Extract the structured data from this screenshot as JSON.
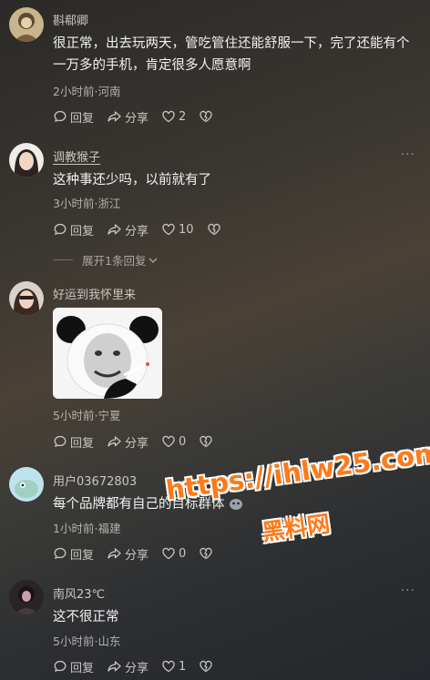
{
  "comments": [
    {
      "username": "斟郗卿",
      "text": "很正常，出去玩两天，管吃管住还能舒服一下，完了还能有个一万多的手机，肯定很多人愿意啊",
      "time": "2小时前",
      "location": "河南",
      "reply": "回复",
      "share": "分享",
      "likes": "2"
    },
    {
      "username": "调教猴子",
      "text": "这种事还少吗，以前就有了",
      "time": "3小时前",
      "location": "浙江",
      "reply": "回复",
      "share": "分享",
      "likes": "10",
      "more": "···",
      "expand": "展开1条回复"
    },
    {
      "username": "好运到我怀里来",
      "text": "",
      "time": "5小时前",
      "location": "宁夏",
      "reply": "回复",
      "share": "分享",
      "likes": "0"
    },
    {
      "username": "用户03672803",
      "text": "每个品牌都有自己的目标群体",
      "time": "1小时前",
      "location": "福建",
      "reply": "回复",
      "share": "分享",
      "likes": "0"
    },
    {
      "username": "南风23℃",
      "text": "这不很正常",
      "time": "5小时前",
      "location": "山东",
      "reply": "回复",
      "share": "分享",
      "likes": "1",
      "more": "···"
    }
  ],
  "watermark": {
    "url": "https://ihlw25.com",
    "brand": "黑料网"
  },
  "colors": {
    "accent": "#ff7a18"
  }
}
